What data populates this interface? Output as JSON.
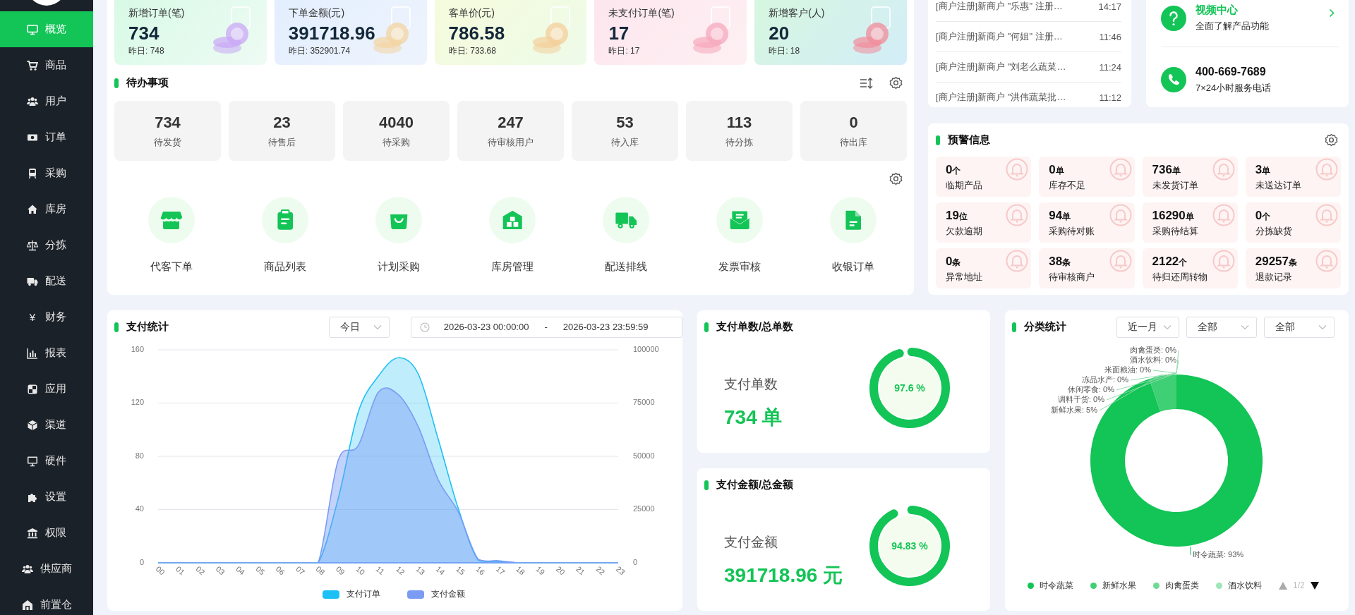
{
  "sidebar": {
    "items": [
      {
        "label": "概览",
        "selected": true
      },
      {
        "label": "商品",
        "selected": false
      },
      {
        "label": "用户",
        "selected": false
      },
      {
        "label": "订单",
        "selected": false
      },
      {
        "label": "采购",
        "selected": false
      },
      {
        "label": "库房",
        "selected": false
      },
      {
        "label": "分拣",
        "selected": false
      },
      {
        "label": "配送",
        "selected": false
      },
      {
        "label": "财务",
        "selected": false,
        "glyph": "¥"
      },
      {
        "label": "报表",
        "selected": false
      },
      {
        "label": "应用",
        "selected": false
      },
      {
        "label": "渠道",
        "selected": false
      },
      {
        "label": "硬件",
        "selected": false
      },
      {
        "label": "设置",
        "selected": false
      },
      {
        "label": "权限",
        "selected": false
      },
      {
        "label": "供应商",
        "selected": false
      },
      {
        "label": "前置仓",
        "selected": false
      }
    ]
  },
  "stats": [
    {
      "label": "新增订单(笔)",
      "value": "734",
      "previous": "昨日: 748"
    },
    {
      "label": "下单金额(元)",
      "value": "391718.96",
      "previous": "昨日: 352901.74"
    },
    {
      "label": "客单价(元)",
      "value": "786.58",
      "previous": "昨日: 733.68"
    },
    {
      "label": "未支付订单(笔)",
      "value": "17",
      "previous": "昨日: 17"
    },
    {
      "label": "新增客户(人)",
      "value": "20",
      "previous": "昨日: 18"
    }
  ],
  "todo": {
    "title": "待办事项",
    "items": [
      {
        "value": "734",
        "label": "待发货"
      },
      {
        "value": "23",
        "label": "待售后"
      },
      {
        "value": "4040",
        "label": "待采购"
      },
      {
        "value": "247",
        "label": "待审核用户"
      },
      {
        "value": "53",
        "label": "待入库"
      },
      {
        "value": "113",
        "label": "待分拣"
      },
      {
        "value": "0",
        "label": "待出库"
      }
    ]
  },
  "shortcuts": [
    {
      "label": "代客下单"
    },
    {
      "label": "商品列表"
    },
    {
      "label": "计划采购"
    },
    {
      "label": "库房管理"
    },
    {
      "label": "配送排线"
    },
    {
      "label": "发票审核"
    },
    {
      "label": "收银订单"
    }
  ],
  "notices": [
    {
      "text": "[商户注册]新商户 \"乐惠\" 注册…",
      "time": "14:17"
    },
    {
      "text": "[商户注册]新商户 \"何姐\" 注册…",
      "time": "11:46"
    },
    {
      "text": "[商户注册]新商户 \"刘老么蔬菜…",
      "time": "11:24"
    },
    {
      "text": "[商户注册]新商户 \"洪伟蔬菜批…",
      "time": "11:12"
    }
  ],
  "help": {
    "video": {
      "title": "视频中心",
      "subtitle": "全面了解产品功能"
    },
    "phone": {
      "number": "400-669-7689",
      "subtitle": "7×24小时服务电话"
    }
  },
  "alerts": {
    "title": "预警信息",
    "items": [
      {
        "value": "0",
        "unit": "个",
        "label": "临期产品"
      },
      {
        "value": "0",
        "unit": "单",
        "label": "库存不足"
      },
      {
        "value": "736",
        "unit": "单",
        "label": "未发货订单"
      },
      {
        "value": "3",
        "unit": "单",
        "label": "未送达订单"
      },
      {
        "value": "19",
        "unit": "位",
        "label": "欠款逾期"
      },
      {
        "value": "94",
        "unit": "单",
        "label": "采购待对账"
      },
      {
        "value": "16290",
        "unit": "单",
        "label": "采购待结算"
      },
      {
        "value": "0",
        "unit": "个",
        "label": "分拣缺货"
      },
      {
        "value": "0",
        "unit": "条",
        "label": "异常地址"
      },
      {
        "value": "38",
        "unit": "条",
        "label": "待审核商户"
      },
      {
        "value": "2122",
        "unit": "个",
        "label": "待归还周转物"
      },
      {
        "value": "29257",
        "unit": "条",
        "label": "退款记录"
      }
    ]
  },
  "payment": {
    "title": "支付统计",
    "range": "今日",
    "date_start": "2026-03-23 00:00:00",
    "date_separator": "-",
    "date_end": "2026-03-23 23:59:59",
    "chart_data": {
      "type": "area",
      "x": [
        "00",
        "01",
        "02",
        "03",
        "04",
        "05",
        "06",
        "07",
        "08",
        "09",
        "10",
        "11",
        "12",
        "13",
        "14",
        "15",
        "16",
        "17",
        "18",
        "19",
        "20",
        "21",
        "22",
        "23"
      ],
      "series": [
        {
          "name": "支付订单",
          "color": "#1cc0f5",
          "values": [
            0,
            0,
            0,
            0,
            0,
            0,
            0,
            0,
            0,
            48,
            113,
            140,
            154,
            142,
            93,
            41,
            2,
            1,
            0,
            0,
            0,
            0,
            0,
            0
          ]
        }
      ],
      "ylim": [
        0,
        160
      ],
      "yticks": [
        0,
        40,
        80,
        120,
        160
      ],
      "grid": true,
      "legend": "bottom"
    },
    "amount_axis": {
      "chart_data": {
        "type": "area",
        "series": [
          {
            "name": "支付金额",
            "color": "#7b9cf5",
            "values": [
              0,
              0,
              0,
              0,
              0,
              0,
              0,
              0,
              0,
              48000,
              55000,
              80000,
              79000,
              64000,
              39000,
              24000,
              1700,
              1000,
              0,
              0,
              0,
              0,
              0,
              0
            ]
          }
        ],
        "ylim": [
          0,
          100000
        ],
        "yticks": [
          0,
          25000,
          50000,
          75000,
          100000
        ]
      }
    }
  },
  "pay_count": {
    "title": "支付单数/总单数",
    "label": "支付单数",
    "value": "734 单",
    "percent": "97.6 %",
    "level": 0.976
  },
  "pay_amount": {
    "title": "支付金额/总金额",
    "label": "支付金额",
    "value": "391718.96 元",
    "percent": "94.83 %",
    "level": 0.9483
  },
  "category": {
    "title": "分类统计",
    "filters": [
      "近一月",
      "全部",
      "全部"
    ],
    "chart_data": {
      "type": "donut",
      "values": [
        93,
        5,
        0,
        0,
        0,
        0,
        0,
        0
      ],
      "value_labels": [
        "时令蔬菜: 93%",
        "新鲜水果: 5%",
        "肉禽蛋类: 0%",
        "酒水饮料: 0%",
        "米面粮油: 0%",
        "冻品水产: 0%",
        "休闲零食: 0%",
        "调料干货: 0%"
      ]
    },
    "legend": [
      {
        "label": "时令蔬菜",
        "color": "#13c456"
      },
      {
        "label": "新鲜水果",
        "color": "#3fcf74"
      },
      {
        "label": "肉禽蛋类",
        "color": "#70d996"
      },
      {
        "label": "酒水饮料",
        "color": "#a0e5b9"
      }
    ],
    "legend_page": "1/2"
  }
}
